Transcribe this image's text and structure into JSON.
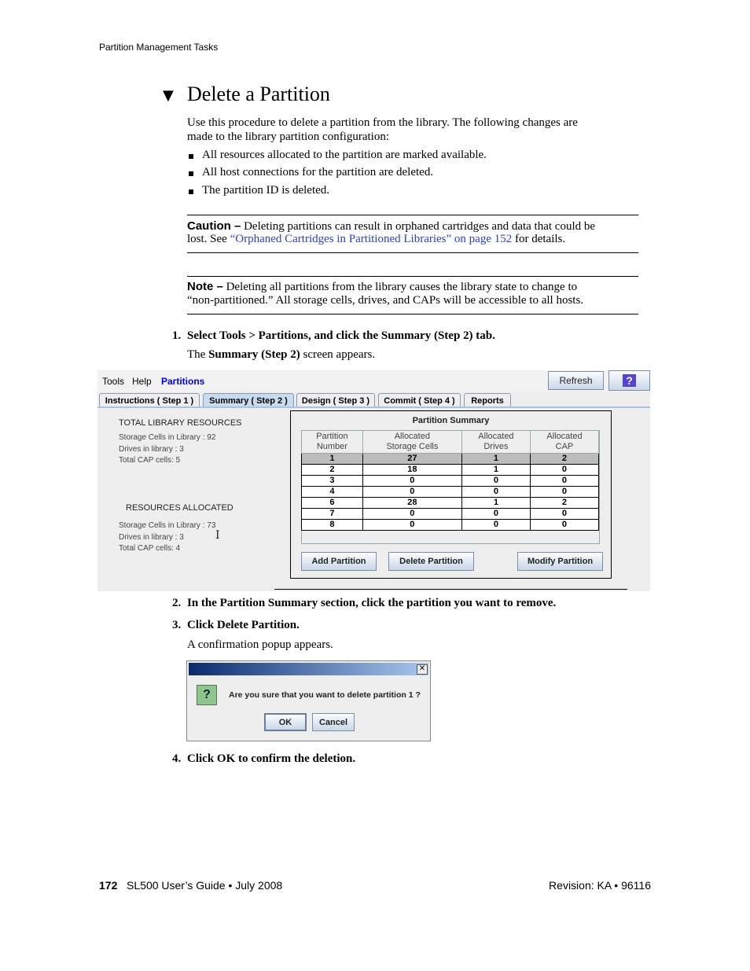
{
  "running_header": "Partition Management Tasks",
  "title": "Delete a Partition",
  "intro": [
    "Use this procedure to delete a partition from the library. The following changes are",
    "made to the library partition configuration:"
  ],
  "bullets": [
    "All resources allocated to the partition are marked available.",
    "All host connections for the partition are deleted.",
    "The partition ID is deleted."
  ],
  "caution": {
    "label": "Caution –",
    "line1": "Deleting partitions can result in orphaned cartridges and data that could be",
    "line2_pre": "lost. See ",
    "link": "“Orphaned Cartridges in Partitioned Libraries” on page 152",
    "line2_post": " for details."
  },
  "note": {
    "label": "Note –",
    "line1": "Deleting all partitions from the library causes the library state to change to",
    "line2": "“non-partitioned.” All storage cells, drives, and CAPs will be accessible to all hosts."
  },
  "steps": [
    {
      "num": "1.",
      "text": "Select Tools > Partitions, and click the Summary (Step 2) tab."
    },
    {
      "num": "2.",
      "text": "In the Partition Summary section, click the partition you want to remove."
    },
    {
      "num": "3.",
      "text": "Click Delete Partition."
    },
    {
      "num": "4.",
      "text": "Click OK to confirm the deletion."
    }
  ],
  "step1_result": {
    "pre": "The ",
    "bold": "Summary (Step 2)",
    "post": " screen appears."
  },
  "step3_result": "A confirmation popup appears.",
  "app": {
    "menu": [
      "Tools",
      "Help",
      "Partitions"
    ],
    "refresh": "Refresh",
    "help_icon": "?",
    "tabs": [
      "Instructions ( Step 1 )",
      "Summary ( Step 2 )",
      "Design ( Step 3 )",
      "Commit ( Step 4 )",
      "Reports"
    ],
    "total": {
      "heading": "TOTAL LIBRARY RESOURCES",
      "lines": [
        "Storage Cells in Library : 92",
        "Drives in library : 3",
        "Total CAP cells: 5"
      ]
    },
    "allocated": {
      "heading": "RESOURCES ALLOCATED",
      "lines": [
        "Storage Cells in Library : 73",
        "Drives in library : 3",
        "Total CAP cells: 4"
      ]
    },
    "summary_title": "Partition Summary",
    "columns": [
      [
        "Partition",
        "Number"
      ],
      [
        "Allocated",
        "Storage Cells"
      ],
      [
        "Allocated",
        "Drives"
      ],
      [
        "Allocated",
        "CAP"
      ]
    ],
    "rows": [
      [
        "1",
        "27",
        "1",
        "2"
      ],
      [
        "2",
        "18",
        "1",
        "0"
      ],
      [
        "3",
        "0",
        "0",
        "0"
      ],
      [
        "4",
        "0",
        "0",
        "0"
      ],
      [
        "6",
        "28",
        "1",
        "2"
      ],
      [
        "7",
        "0",
        "0",
        "0"
      ],
      [
        "8",
        "0",
        "0",
        "0"
      ]
    ],
    "selected_row": 0,
    "buttons": [
      "Add Partition",
      "Delete Partition",
      "Modify Partition"
    ],
    "accent": "#0000ee"
  },
  "dialog": {
    "message": "Are you sure that you want to delete partition 1 ?",
    "ok": "OK",
    "cancel": "Cancel",
    "icon": "?"
  },
  "footer": {
    "page": "172",
    "guide": "SL500 User’s Guide  •  July 2008",
    "revision": "Revision: KA  •  96116"
  }
}
